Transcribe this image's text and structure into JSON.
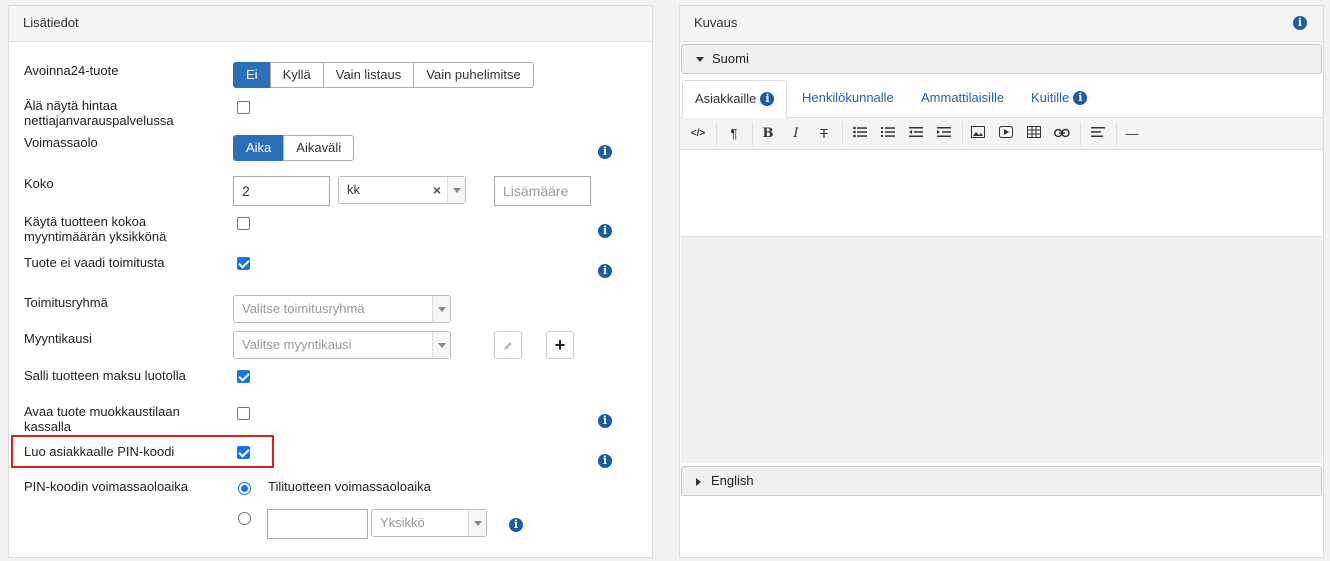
{
  "left_panel": {
    "title": "Lisätiedot",
    "rows": {
      "avoinna": {
        "label": "Avoinna24-tuote",
        "options": [
          "Ei",
          "Kyllä",
          "Vain listaus",
          "Vain puhelimitse"
        ],
        "selected": "Ei"
      },
      "hide_price": {
        "label_line1": "Älä näytä hintaa",
        "label_line2": "nettiajanvarauspalvelussa",
        "checked": false
      },
      "validity": {
        "label": "Voimassaolo",
        "options": [
          "Aika",
          "Aikaväli"
        ],
        "selected": "Aika"
      },
      "size": {
        "label": "Koko",
        "value": "2",
        "unit": "kk",
        "clear": "×",
        "extra_placeholder": "Lisämääre"
      },
      "use_size": {
        "label_line1": "Käytä tuotteen kokoa",
        "label_line2": "myyntimäärän yksikkönä",
        "checked": false
      },
      "no_delivery": {
        "label": "Tuote ei vaadi toimitusta",
        "checked": true
      },
      "delivery_group": {
        "label": "Toimitusryhmä",
        "placeholder": "Valitse toimitusryhmä"
      },
      "season": {
        "label": "Myyntikausi",
        "placeholder": "Valitse myyntikausi",
        "add": "+"
      },
      "credit": {
        "label": "Salli tuotteen maksu luotolla",
        "checked": true
      },
      "edit_mode": {
        "label_line1": "Avaa tuote muokkaustilaan",
        "label_line2": "kassalla",
        "checked": false
      },
      "pin": {
        "label": "Luo asiakkaalle PIN-koodi",
        "checked": true
      },
      "pin_validity": {
        "label": "PIN-koodin voimassaoloaika",
        "option1": "Tilituotteen voimassaoloaika",
        "unit_placeholder": "Yksikkö"
      }
    }
  },
  "right_panel": {
    "title": "Kuvaus",
    "lang1": "Suomi",
    "lang2": "English",
    "tabs": [
      "Asiakkaille",
      "Henkilökunnalle",
      "Ammattilaisille",
      "Kuitille"
    ],
    "toolbar": {
      "code": "</>",
      "para": "¶",
      "bold": "B",
      "italic": "I",
      "strike": "T",
      "hr": "—"
    }
  },
  "icons": {
    "info": "i"
  },
  "colors": {
    "primary": "#2a6fb8",
    "info": "#1a5ca8",
    "highlight": "#e02020",
    "link": "#1a63b8"
  }
}
